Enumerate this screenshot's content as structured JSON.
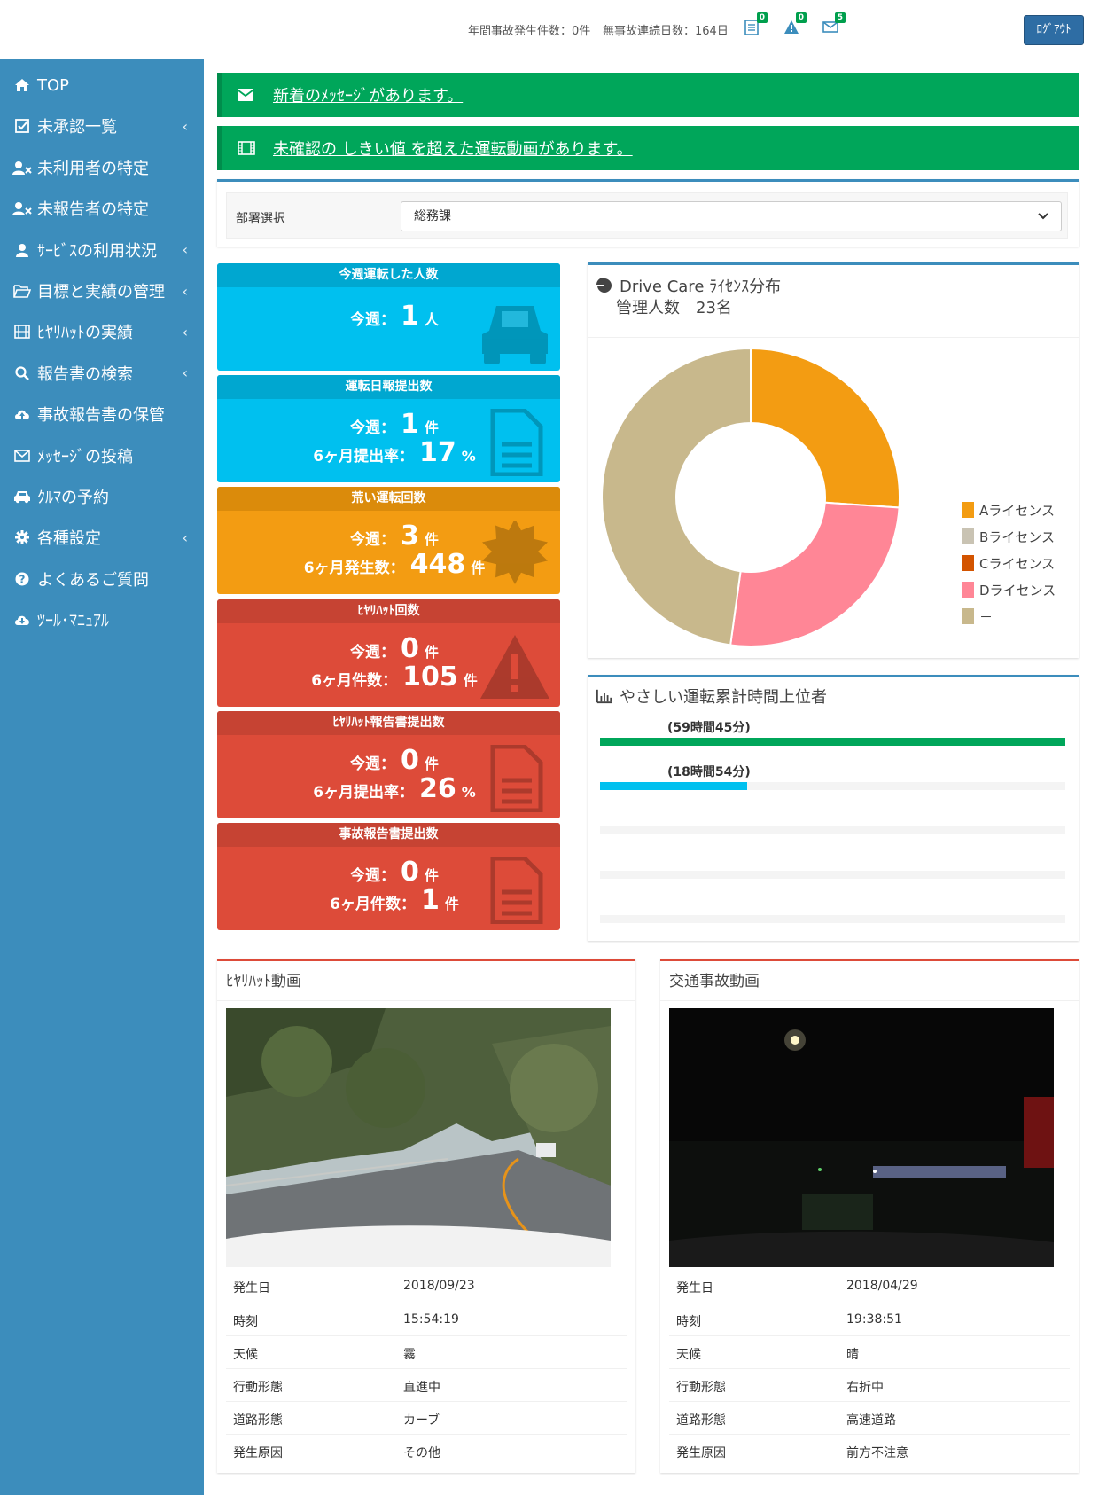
{
  "header": {
    "annual_accidents": "年間事故発生件数：0件",
    "no_accident_days": "無事故連続日数：164日",
    "badges": {
      "report": "0",
      "warning": "0",
      "mail": "5"
    },
    "logout_label": "ﾛｸﾞｱｳﾄ"
  },
  "sidebar": {
    "items": [
      {
        "label": "TOP",
        "icon": "home-icon",
        "chevron": false
      },
      {
        "label": "未承認一覧",
        "icon": "check-square-icon",
        "chevron": true
      },
      {
        "label": "未利用者の特定",
        "icon": "user-x-icon",
        "chevron": false
      },
      {
        "label": "未報告者の特定",
        "icon": "user-x-icon",
        "chevron": false
      },
      {
        "label": "ｻｰﾋﾞｽの利用状況",
        "icon": "user-icon",
        "chevron": true
      },
      {
        "label": "目標と実績の管理",
        "icon": "folder-open-icon",
        "chevron": true
      },
      {
        "label": "ﾋﾔﾘﾊｯﾄの実績",
        "icon": "film-icon",
        "chevron": true
      },
      {
        "label": "報告書の検索",
        "icon": "search-icon",
        "chevron": true
      },
      {
        "label": "事故報告書の保管",
        "icon": "cloud-upload-icon",
        "chevron": false
      },
      {
        "label": "ﾒｯｾｰｼﾞの投稿",
        "icon": "envelope-icon",
        "chevron": false
      },
      {
        "label": "ｸﾙﾏの予約",
        "icon": "car-icon",
        "chevron": false
      },
      {
        "label": "各種設定",
        "icon": "gear-icon",
        "chevron": true
      },
      {
        "label": "よくあるご質問",
        "icon": "question-icon",
        "chevron": false
      },
      {
        "label": "ﾂｰﾙ･ﾏﾆｭｱﾙ",
        "icon": "cloud-download-icon",
        "chevron": false
      }
    ],
    "chevron_glyph": "‹"
  },
  "alerts": {
    "message": "新着のﾒｯｾｰｼﾞがあります。",
    "video": "未確認の しきい値 を超えた運転動画があります。"
  },
  "dept": {
    "label": "部署選択",
    "selected": "総務課"
  },
  "boxes": [
    {
      "title": "今週運転した人数",
      "l1_label": "今週：",
      "l1_num": "1",
      "l1_unit": "人"
    },
    {
      "title": "運転日報提出数",
      "l1_label": "今週：",
      "l1_num": "1",
      "l1_unit": "件",
      "l2_label": "6ヶ月提出率：",
      "l2_num": "17",
      "l2_unit": "%"
    },
    {
      "title": "荒い運転回数",
      "l1_label": "今週：",
      "l1_num": "3",
      "l1_unit": "件",
      "l2_label": "6ヶ月発生数：",
      "l2_num": "448",
      "l2_unit": "件"
    },
    {
      "title": "ﾋﾔﾘﾊｯﾄ回数",
      "l1_label": "今週：",
      "l1_num": "0",
      "l1_unit": "件",
      "l2_label": "6ヶ月件数：",
      "l2_num": "105",
      "l2_unit": "件"
    },
    {
      "title": "ﾋﾔﾘﾊｯﾄ報告書提出数",
      "l1_label": "今週：",
      "l1_num": "0",
      "l1_unit": "件",
      "l2_label": "6ヶ月提出率：",
      "l2_num": "26",
      "l2_unit": "%"
    },
    {
      "title": "事故報告書提出数",
      "l1_label": "今週：",
      "l1_num": "0",
      "l1_unit": "件",
      "l2_label": "6ヶ月件数：",
      "l2_num": "1",
      "l2_unit": "件"
    }
  ],
  "license_panel": {
    "title": "Drive Care ﾗｲｾﾝｽ分布",
    "subtitle": "管理人数　23名"
  },
  "chart_data": {
    "type": "pie",
    "categories": [
      "Aライセンス",
      "Bライセンス",
      "Cライセンス",
      "Dライセンス",
      "－"
    ],
    "values": [
      6,
      0,
      0,
      6,
      11
    ],
    "colors": [
      "#f39c12",
      "#c9c3b3",
      "#d35400",
      "#ff8696",
      "#c8b88c"
    ],
    "legend": "right"
  },
  "ranking": {
    "title": "やさしい運転累計時間上位者",
    "bars": [
      {
        "label": "(59時間45分)",
        "fraction": 1.0,
        "color": "#00a65a"
      },
      {
        "label": "(18時間54分)",
        "fraction": 0.316,
        "color": "#00c0ef"
      },
      {
        "label": "",
        "fraction": 0,
        "color": "#f4f4f4"
      },
      {
        "label": "",
        "fraction": 0,
        "color": "#f4f4f4"
      },
      {
        "label": "",
        "fraction": 0,
        "color": "#f4f4f4"
      }
    ]
  },
  "near_miss_video": {
    "title": "ﾋﾔﾘﾊｯﾄ動画",
    "rows": [
      {
        "k": "発生日",
        "v": "2018/09/23"
      },
      {
        "k": "時刻",
        "v": "15:54:19"
      },
      {
        "k": "天候",
        "v": "霧"
      },
      {
        "k": "行動形態",
        "v": "直進中"
      },
      {
        "k": "道路形態",
        "v": "カーブ"
      },
      {
        "k": "発生原因",
        "v": "その他"
      }
    ]
  },
  "accident_video": {
    "title": "交通事故動画",
    "rows": [
      {
        "k": "発生日",
        "v": "2018/04/29"
      },
      {
        "k": "時刻",
        "v": "19:38:51"
      },
      {
        "k": "天候",
        "v": "晴"
      },
      {
        "k": "行動形態",
        "v": "右折中"
      },
      {
        "k": "道路形態",
        "v": "高速道路"
      },
      {
        "k": "発生原因",
        "v": "前方不注意"
      }
    ]
  }
}
